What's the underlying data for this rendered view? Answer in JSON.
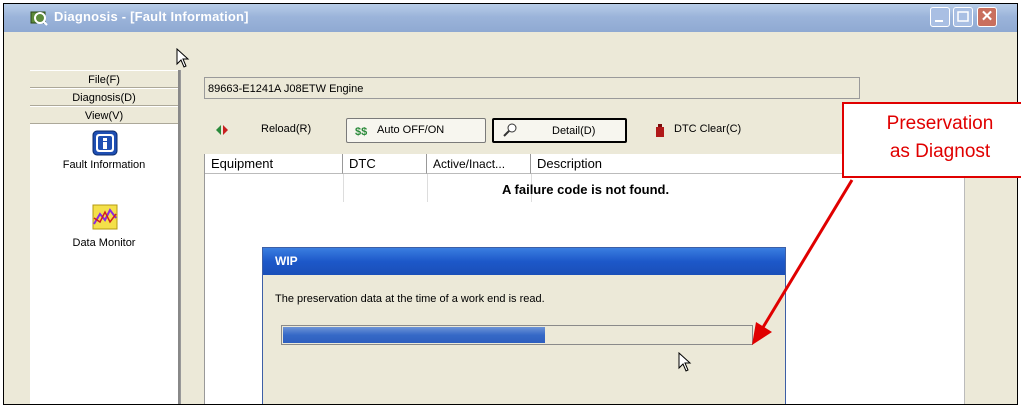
{
  "window": {
    "title": "Diagnosis - [Fault Information]"
  },
  "left_panel": {
    "menu": [
      {
        "label": "File(F)"
      },
      {
        "label": "Diagnosis(D)"
      },
      {
        "label": "View(V)"
      }
    ],
    "nav": [
      {
        "label": "Fault Information",
        "icon": "info-icon"
      },
      {
        "label": "Data Monitor",
        "icon": "data-monitor-icon"
      }
    ]
  },
  "engine_field": {
    "value": "89663-E1241A J08ETW Engine"
  },
  "toolbar": {
    "reload_label": "Reload(R)",
    "auto_label": "Auto OFF/ON",
    "detail_label": "Detail(D)",
    "dtc_clear_label": "DTC Clear(C)"
  },
  "table": {
    "columns": [
      "Equipment",
      "DTC",
      "Active/Inact...",
      "Description"
    ],
    "empty_message": "A failure code is not found."
  },
  "dialog": {
    "title": "WIP",
    "message": "The preservation data at the time of a work end is read.",
    "progress": 0.56
  },
  "callout": {
    "line1": "Preservation",
    "line2": "as Diagnost",
    "color": "#e00000"
  },
  "colors": {
    "titlebar": "#9bb4da",
    "dialog_title": "#1d58c9",
    "progress_fill": "#3669c7",
    "window_bg": "#ece9d8"
  }
}
